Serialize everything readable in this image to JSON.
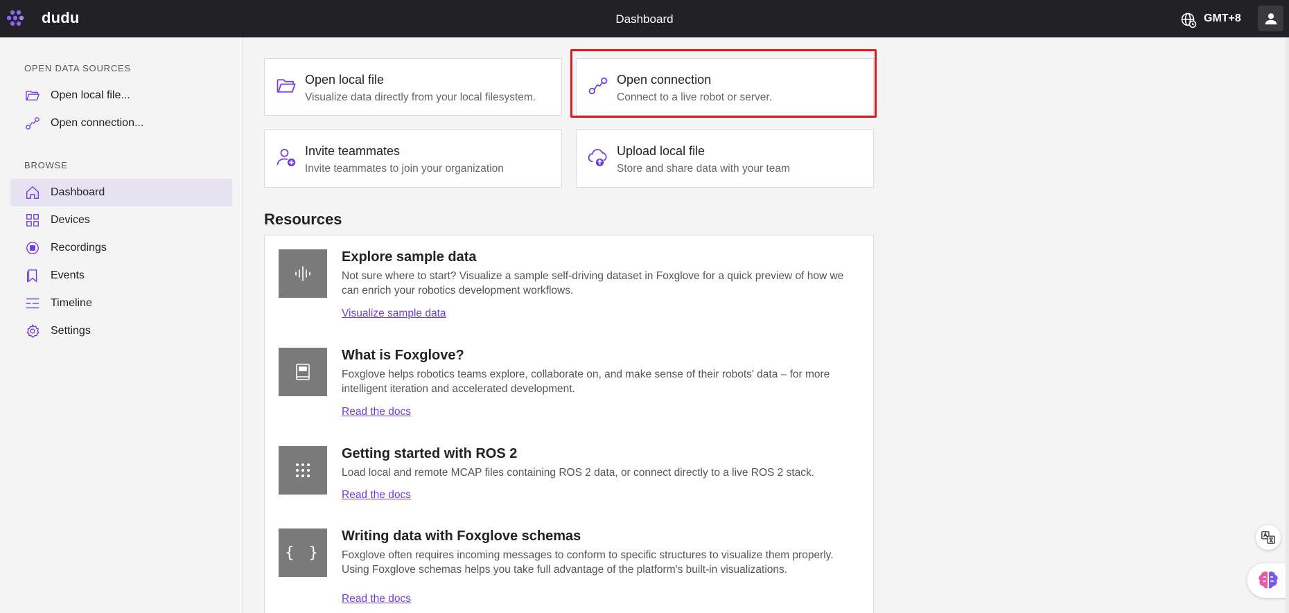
{
  "header": {
    "brand": "dudu",
    "title": "Dashboard",
    "timezone": "GMT+8"
  },
  "sidebar": {
    "open_section": "OPEN DATA SOURCES",
    "open_items": [
      {
        "label": "Open local file...",
        "icon": "folder-open-icon"
      },
      {
        "label": "Open connection...",
        "icon": "connection-icon"
      }
    ],
    "browse_section": "BROWSE",
    "browse_items": [
      {
        "label": "Dashboard",
        "icon": "home-icon",
        "active": true
      },
      {
        "label": "Devices",
        "icon": "grid-icon"
      },
      {
        "label": "Recordings",
        "icon": "record-icon"
      },
      {
        "label": "Events",
        "icon": "bookmark-icon"
      },
      {
        "label": "Timeline",
        "icon": "timeline-icon"
      },
      {
        "label": "Settings",
        "icon": "gear-icon"
      }
    ]
  },
  "actions": [
    {
      "title": "Open local file",
      "subtitle": "Visualize data directly from your local filesystem."
    },
    {
      "title": "Open connection",
      "subtitle": "Connect to a live robot or server."
    },
    {
      "title": "Invite teammates",
      "subtitle": "Invite teammates to join your organization"
    },
    {
      "title": "Upload local file",
      "subtitle": "Store and share data with your team"
    }
  ],
  "resources": {
    "title": "Resources",
    "items": [
      {
        "title": "Explore sample data",
        "description": "Not sure where to start? Visualize a sample self-driving dataset in Foxglove for a quick preview of how we can enrich your robotics development workflows.",
        "link": "Visualize sample data",
        "icon": "waveform-icon"
      },
      {
        "title": "What is Foxglove?",
        "description": "Foxglove helps robotics teams explore, collaborate on, and make sense of their robots' data – for more intelligent iteration and accelerated development.",
        "link": "Read the docs",
        "icon": "book-icon"
      },
      {
        "title": "Getting started with ROS 2",
        "description": "Load local and remote MCAP files containing ROS 2 data, or connect directly to a live ROS 2 stack.",
        "link": "Read the docs",
        "icon": "dots-grid-icon"
      },
      {
        "title": "Writing data with Foxglove schemas",
        "description": "Foxglove often requires incoming messages to conform to specific structures to visualize them properly. Using Foxglove schemas helps you take full advantage of the platform's built-in visualizations.",
        "link": "Read the docs",
        "icon": "braces-icon"
      }
    ]
  },
  "colors": {
    "accent": "#6f3be8",
    "topbar": "#222226",
    "highlight": "#e8151b"
  }
}
